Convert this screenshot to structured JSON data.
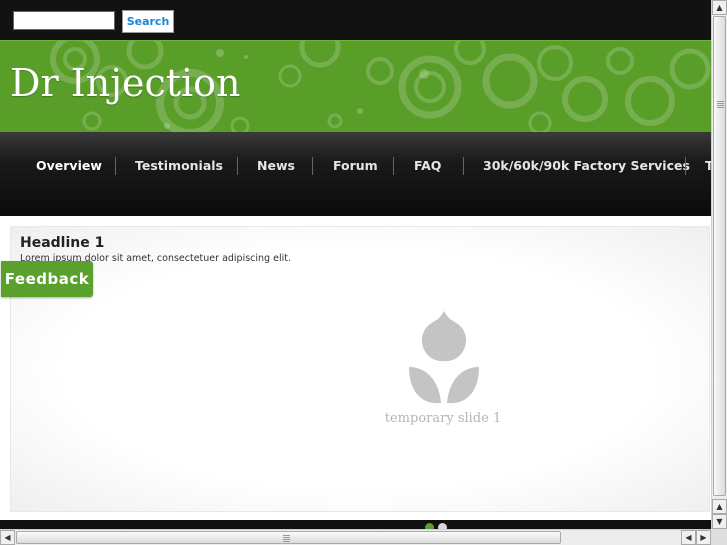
{
  "search": {
    "placeholder": "",
    "value": "",
    "button_label": "Search"
  },
  "header": {
    "title": "Dr Injection"
  },
  "nav": {
    "items": [
      {
        "label": "Overview",
        "active": true
      },
      {
        "label": "Testimonials"
      },
      {
        "label": "News"
      },
      {
        "label": "Forum"
      },
      {
        "label": "FAQ"
      },
      {
        "label": "30k/60k/90k Factory Services"
      },
      {
        "label": "T"
      }
    ]
  },
  "slide": {
    "headline": "Headline 1",
    "text": "Lorem ipsum dolor sit amet, consectetuer adipiscing elit.",
    "caption": "temporary slide 1",
    "current": 1,
    "total": 2
  },
  "feedback": {
    "label": "Feedback"
  },
  "colors": {
    "brand_green": "#5a9e2a",
    "nav_dark": "#111111",
    "link_blue": "#1a86d6"
  },
  "icons": [
    "tulip-placeholder-icon",
    "scroll-up-arrow-icon",
    "scroll-down-arrow-icon",
    "scroll-left-arrow-icon",
    "scroll-right-arrow-icon"
  ]
}
